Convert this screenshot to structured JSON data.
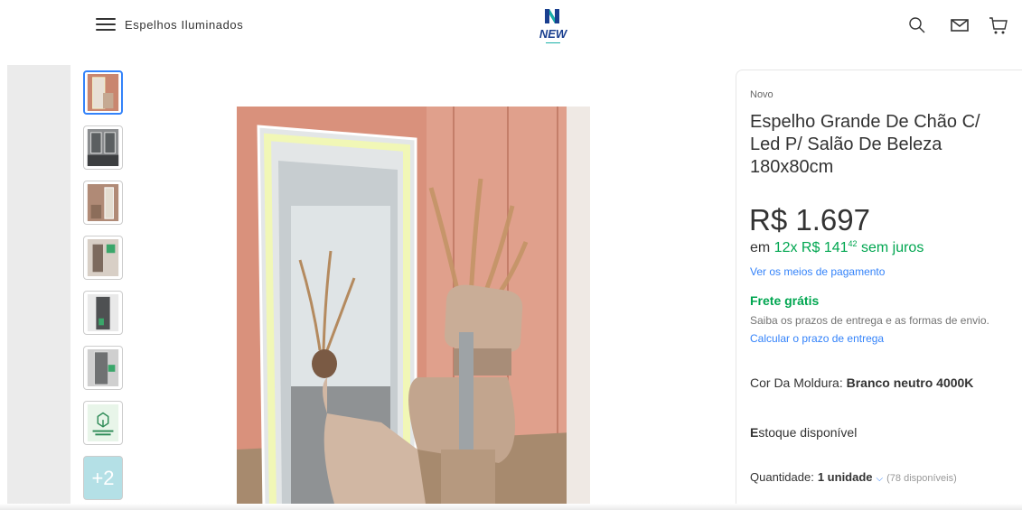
{
  "header": {
    "brand_text": "Espelhos Iluminados",
    "logo_text": "New",
    "icons": [
      "menu-icon",
      "search-icon",
      "mail-icon",
      "cart-icon"
    ]
  },
  "gallery": {
    "thumbnails": [
      {
        "icon": "photo-thumbnail",
        "color": "#c9866f"
      },
      {
        "icon": "photo-thumbnail",
        "color": "#5b5f61"
      },
      {
        "icon": "photo-thumbnail",
        "color": "#b08a76"
      },
      {
        "icon": "photo-thumbnail",
        "color": "#7c6a5e"
      },
      {
        "icon": "photo-thumbnail",
        "color": "#4e5052"
      },
      {
        "icon": "photo-thumbnail",
        "color": "#6f7172"
      },
      {
        "icon": "box-icon",
        "color": "#e8f5e9"
      }
    ],
    "more_label": "+2"
  },
  "product": {
    "condition": "Novo",
    "title": "Espelho Grande De Chão C/ Led P/ Salão De Beleza 180x80cm",
    "price": "R$ 1.697",
    "installments_prefix": "em ",
    "installments_amount": "12x R$ 141",
    "installments_cents": "42",
    "installments_suffix": " sem juros",
    "payment_link": "Ver os meios de pagamento",
    "shipping_title": "Frete grátis",
    "shipping_info": "Saiba os prazos de entrega e as formas de envio.",
    "shipping_link": "Calcular o prazo de entrega",
    "color_label": "Cor Da Moldura: ",
    "color_value": "Branco neutro 4000K",
    "stock_first": "E",
    "stock_rest": "stoque disponível",
    "quantity_label": "Quantidade: ",
    "quantity_value": "1 unidade",
    "quantity_available": "(78 disponíveis)"
  },
  "colors": {
    "accent_blue": "#3483fa",
    "green": "#00a650",
    "wall": "#d9917c"
  }
}
